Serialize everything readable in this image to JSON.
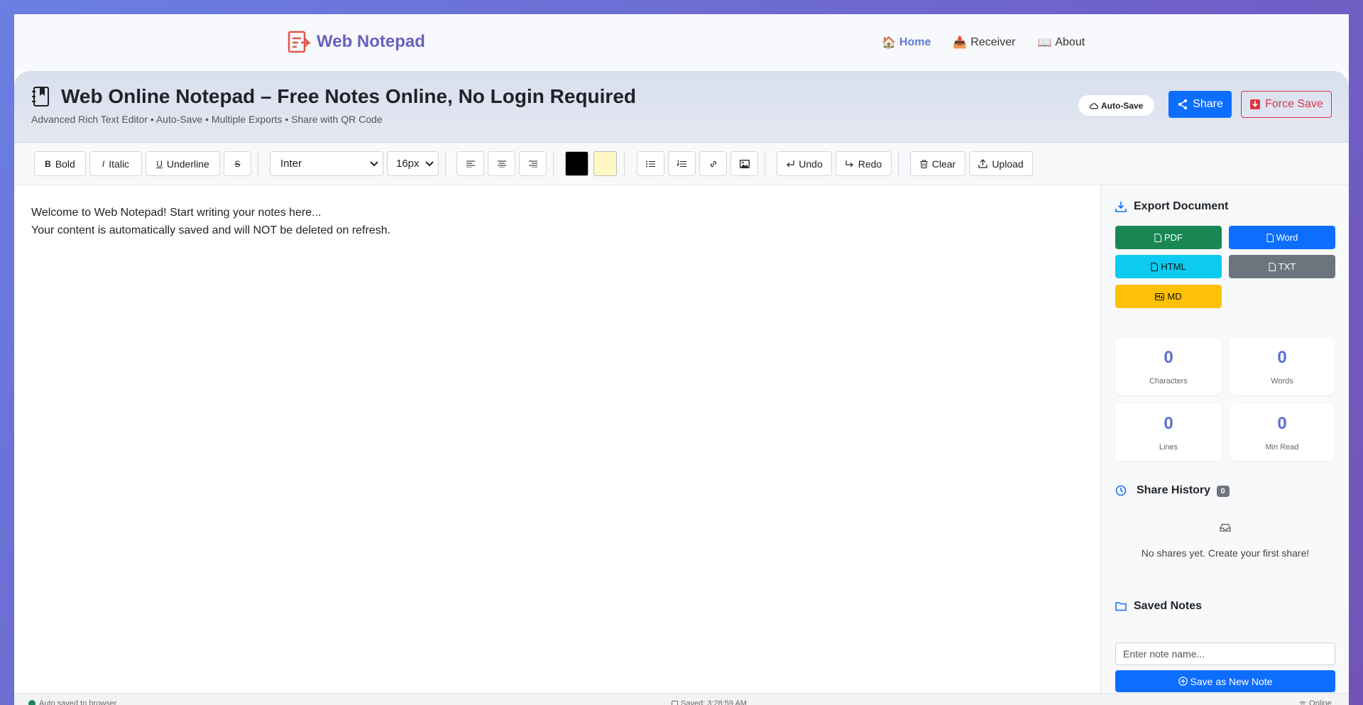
{
  "navbar": {
    "brand": "Web Notepad",
    "links": [
      {
        "label": "Home",
        "emoji": "🏠"
      },
      {
        "label": "Receiver",
        "emoji": "📥"
      },
      {
        "label": "About",
        "emoji": "📖"
      }
    ]
  },
  "header": {
    "title": "Web Online Notepad – Free Notes Online, No Login Required",
    "subtitle": "Advanced Rich Text Editor • Auto-Save • Multiple Exports • Share with QR Code",
    "autosave_label": "Auto-Save",
    "share_label": "Share",
    "force_save_label": "Force Save"
  },
  "toolbar": {
    "bold": "Bold",
    "italic": "Italic",
    "underline": "Underline",
    "font_family": "Inter",
    "font_size": "16px",
    "undo": "Undo",
    "redo": "Redo",
    "clear": "Clear",
    "upload": "Upload",
    "text_color": "#000000",
    "highlight_color": "#fff8c4"
  },
  "editor": {
    "line1": "Welcome to Web Notepad! Start writing your notes here...",
    "line2": "Your content is automatically saved and will NOT be deleted on refresh."
  },
  "sidebar": {
    "export_title": "Export Document",
    "exports": {
      "pdf": "PDF",
      "word": "Word",
      "html": "HTML",
      "txt": "TXT",
      "md": "MD"
    },
    "stats": {
      "characters": {
        "value": "0",
        "label": "Characters"
      },
      "words": {
        "value": "0",
        "label": "Words"
      },
      "lines": {
        "value": "0",
        "label": "Lines"
      },
      "min_read": {
        "value": "0",
        "label": "Min Read"
      }
    },
    "share_history_title": "Share History",
    "share_history_count": "0",
    "empty_text": "No shares yet. Create your first share!",
    "saved_notes_title": "Saved Notes",
    "note_placeholder": "Enter note name...",
    "save_new_note": "Save as New Note"
  },
  "statusbar": {
    "left": "Auto saved to browser",
    "middle": "Saved: 3:28:59 AM",
    "right": "Online"
  },
  "colors": {
    "primary": "#0d6efd",
    "success": "#198754",
    "info": "#0dcaf0",
    "secondary": "#6c757d",
    "warning": "#ffc107",
    "danger": "#dc3545",
    "brand": "#6a5fbf"
  }
}
